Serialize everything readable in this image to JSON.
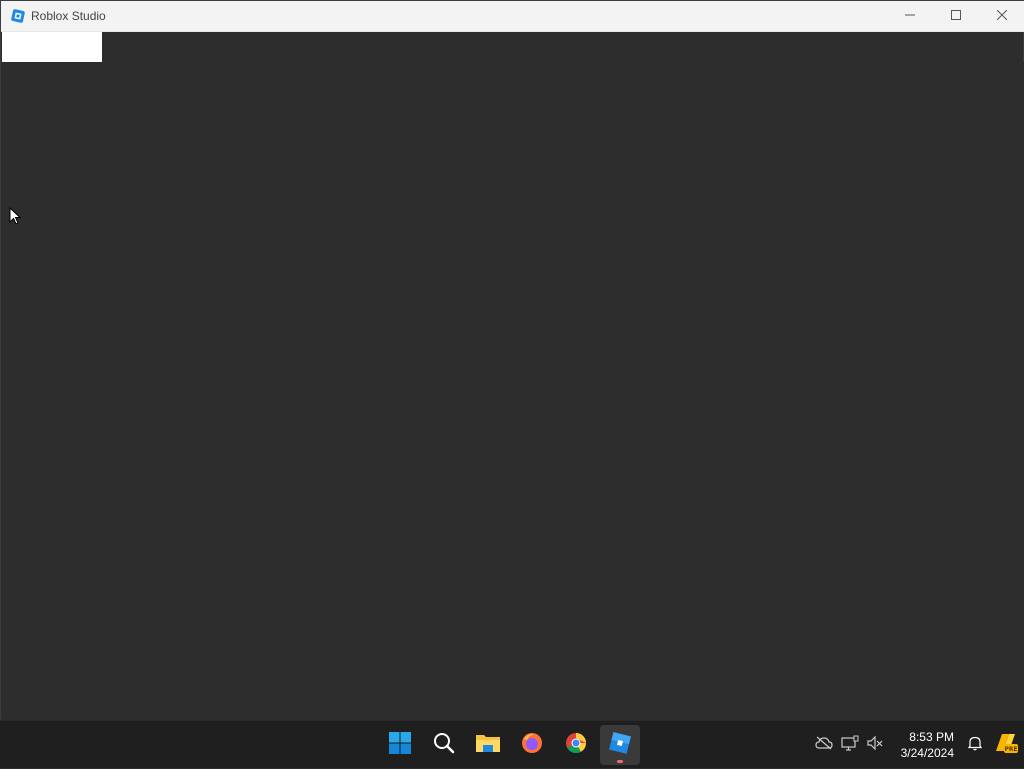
{
  "window": {
    "title": "Roblox Studio",
    "controls": {
      "minimize": "minimize-icon",
      "maximize": "maximize-icon",
      "close": "close-icon"
    }
  },
  "taskbar": {
    "apps": [
      {
        "name": "start",
        "icon": "windows-start-icon"
      },
      {
        "name": "search",
        "icon": "search-icon"
      },
      {
        "name": "file-explorer",
        "icon": "folder-icon"
      },
      {
        "name": "firefox",
        "icon": "firefox-icon"
      },
      {
        "name": "chrome",
        "icon": "chrome-icon"
      },
      {
        "name": "roblox-studio",
        "icon": "roblox-studio-icon",
        "active": true
      }
    ],
    "tray": {
      "icons": [
        "cloud-offline-icon",
        "network-icon",
        "volume-muted-icon"
      ],
      "time": "8:53 PM",
      "date": "3/24/2024",
      "pre_badge": "PRE"
    }
  },
  "colors": {
    "canvas": "#2d2d2d",
    "titlebar": "#f3f3f3",
    "taskbar": "#1f1f1f",
    "accent": "#0078d4"
  }
}
